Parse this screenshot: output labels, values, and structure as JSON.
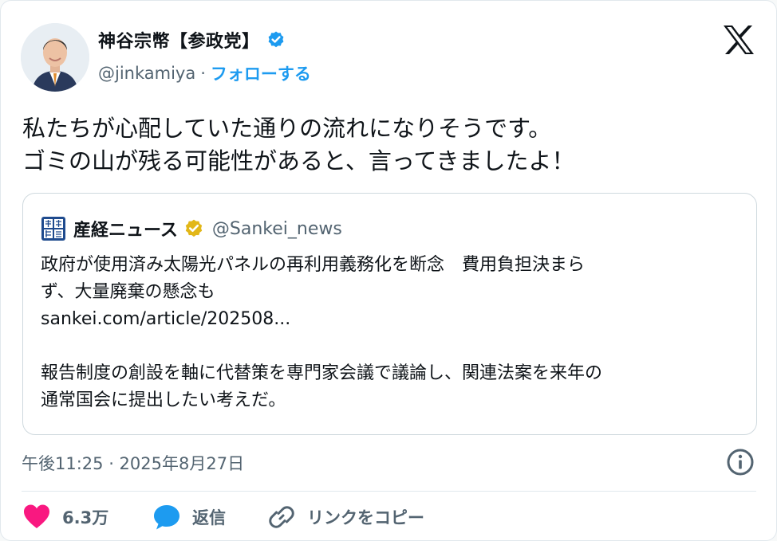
{
  "author": {
    "name": "神谷宗幣【参政党】",
    "handle": "@jinkamiya",
    "separator": "·",
    "follow_label": "フォローする"
  },
  "tweet": {
    "lines": [
      "私たちが心配していた通りの流れになりそうです。",
      "ゴミの山が残る可能性があると、言ってきましたよ！"
    ]
  },
  "quote": {
    "name": "産経ニュース",
    "handle": "@Sankei_news",
    "lines": [
      "政府が使用済み太陽光パネルの再利用義務化を断念　費用負担決まら",
      "ず、大量廃棄の懸念も",
      "sankei.com/article/202508...",
      "",
      "報告制度の創設を軸に代替策を専門家会議で議論し、関連法案を来年の",
      "通常国会に提出したい考えだ。"
    ]
  },
  "meta": {
    "timestamp": "午後11:25 · 2025年8月27日"
  },
  "actions": {
    "like_count": "6.3万",
    "reply_label": "返信",
    "copy_link_label": "リンクをコピー"
  },
  "colors": {
    "accent": "#1d9bf0",
    "like": "#f91880",
    "gold_badge": "#e2b719",
    "secondary_text": "#536471"
  },
  "icons": {
    "verified": "verified-badge-icon",
    "brand": "x-logo-icon",
    "info": "info-icon",
    "like": "heart-icon",
    "reply": "speech-bubble-icon",
    "link": "link-icon"
  }
}
